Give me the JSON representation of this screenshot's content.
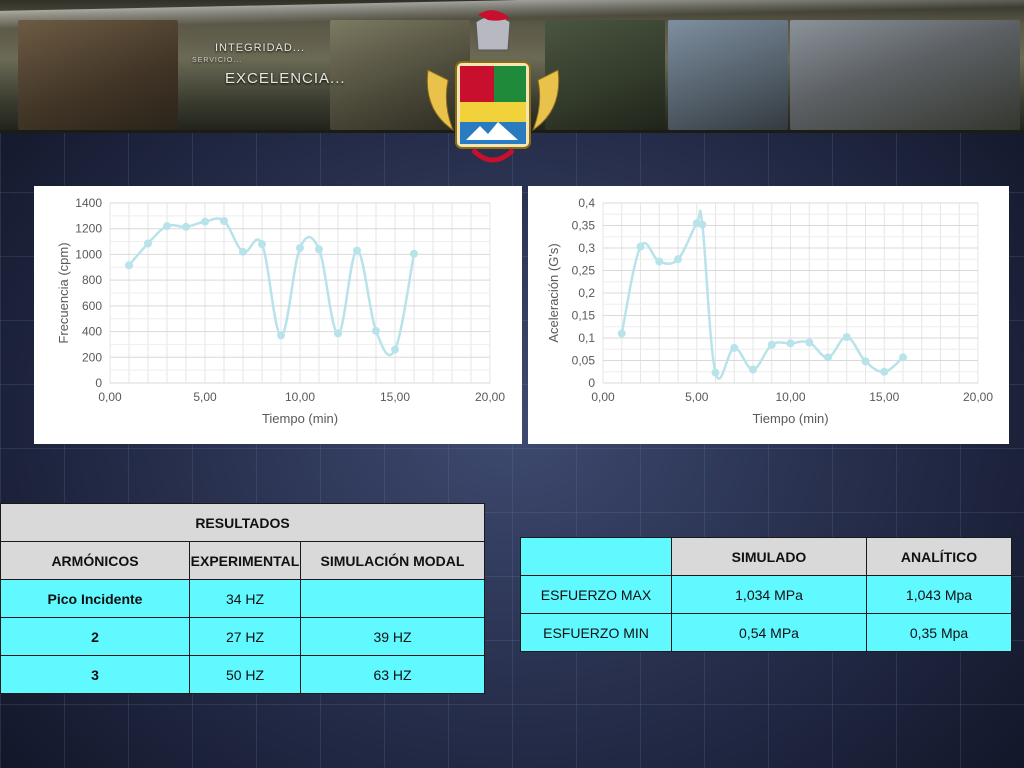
{
  "banner": {
    "slogan_top": "INTEGRIDAD...",
    "slogan_small": "SERVICIO...",
    "slogan_main": "EXCELENCIA..."
  },
  "chart_data": [
    {
      "type": "line",
      "xlabel": "Tiempo (min)",
      "ylabel": "Frecuencia (cpm)",
      "xlim": [
        0,
        20
      ],
      "ylim": [
        0,
        1400
      ],
      "x_ticks": [
        "0,00",
        "5,00",
        "10,00",
        "15,00",
        "20,00"
      ],
      "y_ticks": [
        "0",
        "200",
        "400",
        "600",
        "800",
        "1000",
        "1200",
        "1400"
      ],
      "grid": true,
      "line_color": "#b9e3ea",
      "x": [
        1,
        2,
        3,
        4,
        5,
        6,
        7,
        8,
        9,
        10,
        11,
        12,
        13,
        14,
        15,
        16
      ],
      "y": [
        915,
        1085,
        1220,
        1215,
        1255,
        1260,
        1020,
        1080,
        370,
        1050,
        1040,
        385,
        1030,
        405,
        260,
        1005
      ]
    },
    {
      "type": "line",
      "xlabel": "Tiempo (min)",
      "ylabel": "Aceleración (G's)",
      "xlim": [
        0,
        20
      ],
      "ylim": [
        0,
        0.4
      ],
      "x_ticks": [
        "0,00",
        "5,00",
        "10,00",
        "15,00",
        "20,00"
      ],
      "y_ticks": [
        "0",
        "0,05",
        "0,1",
        "0,15",
        "0,2",
        "0,25",
        "0,3",
        "0,35",
        "0,4"
      ],
      "grid": true,
      "line_color": "#b9e3ea",
      "x": [
        1,
        2,
        3,
        4,
        5,
        5.3,
        6,
        7,
        8,
        9,
        10,
        11,
        12,
        13,
        14,
        15,
        16
      ],
      "y": [
        0.11,
        0.303,
        0.27,
        0.275,
        0.355,
        0.352,
        0.023,
        0.078,
        0.03,
        0.085,
        0.088,
        0.09,
        0.057,
        0.102,
        0.048,
        0.025,
        0.057
      ]
    }
  ],
  "table_resultados": {
    "title": "RESULTADOS",
    "headers": [
      "ARMÓNICOS",
      "EXPERIMENTAL",
      "SIMULACIÓN MODAL"
    ],
    "rows": [
      [
        "Pico Incidente",
        "34 HZ",
        ""
      ],
      [
        "2",
        "27 HZ",
        "39 HZ"
      ],
      [
        "3",
        "50 HZ",
        "63 HZ"
      ]
    ]
  },
  "table_esfuerzo": {
    "headers": [
      "",
      "SIMULADO",
      "ANALÍTICO"
    ],
    "rows": [
      [
        "ESFUERZO MAX",
        "1,034 MPa",
        "1,043 Mpa"
      ],
      [
        "ESFUERZO MIN",
        "0,54 MPa",
        "0,35 Mpa"
      ]
    ]
  },
  "colors": {
    "table_cell": "#5ff9ff",
    "table_header": "#d9d9d9",
    "series_line": "#b9e3ea"
  }
}
